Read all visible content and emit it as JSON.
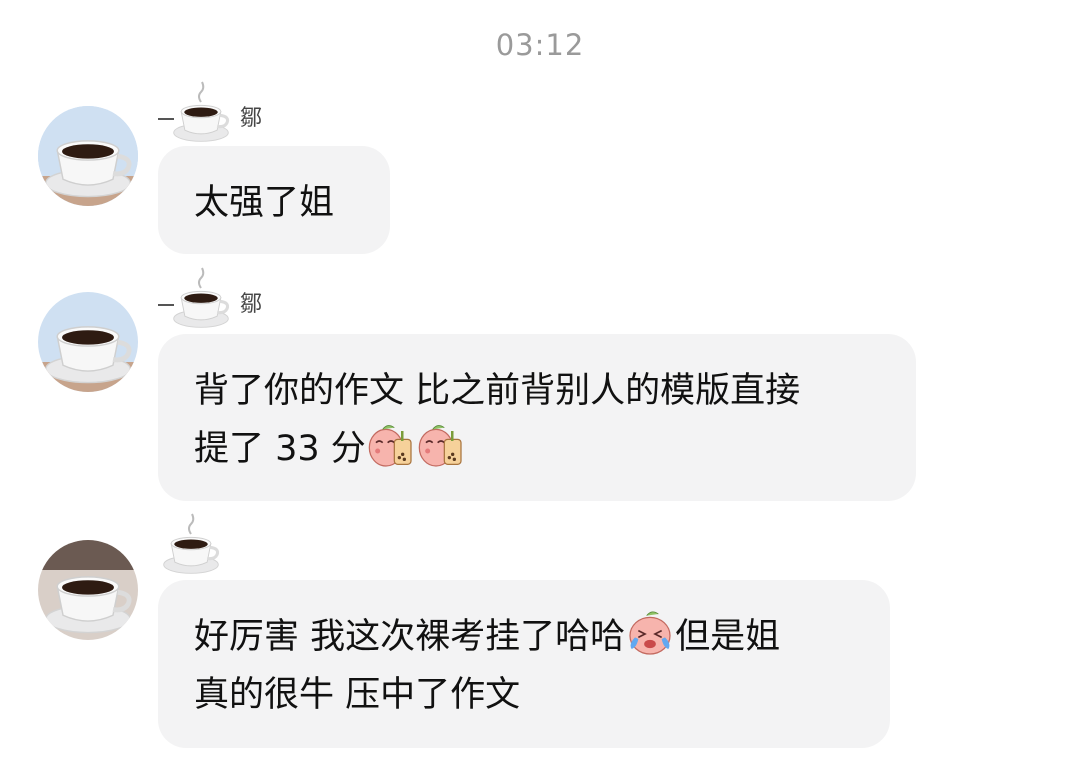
{
  "timestamp": "03:12",
  "messages": [
    {
      "avatar_icon": "coffee-cup-icon",
      "sender_icon": "coffee-cup-icon",
      "sender_partial_char": "鄒",
      "text": "太强了姐"
    },
    {
      "avatar_icon": "coffee-cup-icon",
      "sender_icon": "coffee-cup-icon",
      "sender_partial_char": "鄒",
      "line1": "背了你的作文 比之前背别人的模版直接",
      "line2": "提了 33 分",
      "emojis": [
        "peach-bubble-tea-emoji",
        "peach-bubble-tea-emoji"
      ]
    },
    {
      "avatar_icon": "coffee-cup-icon",
      "sender_icon": "coffee-cup-icon",
      "line1_a": "好厉害 我这次裸考挂了哈哈",
      "line1_emoji": "peach-laugh-cry-emoji",
      "line1_b": "但是姐",
      "line2": "真的很牛 压中了作文"
    }
  ],
  "colors": {
    "bubble": "#f3f3f4",
    "timestamp": "#9a9a9a",
    "text": "#111111"
  }
}
